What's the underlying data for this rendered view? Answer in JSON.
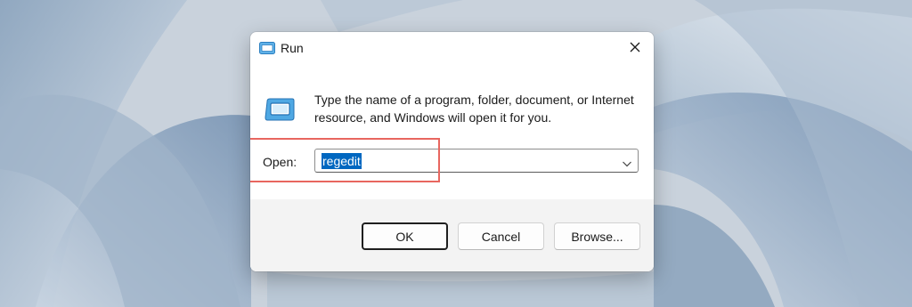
{
  "dialog": {
    "title": "Run",
    "description": "Type the name of a program, folder, document, or Internet resource, and Windows will open it for you.",
    "open_label": "Open:",
    "open_value": "regedit",
    "buttons": {
      "ok": "OK",
      "cancel": "Cancel",
      "browse": "Browse..."
    },
    "icons": {
      "title": "run-icon",
      "content": "run-icon",
      "close": "close-icon",
      "dropdown": "chevron-down-icon"
    }
  },
  "colors": {
    "selection": "#0067c0",
    "highlight_box": "#e8665f",
    "footer_bg": "#f3f3f3"
  }
}
